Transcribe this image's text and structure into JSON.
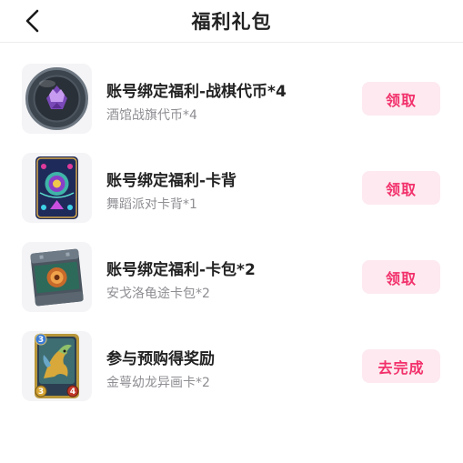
{
  "header": {
    "title": "福利礼包",
    "back_icon": "chevron-left-icon"
  },
  "colors": {
    "accent": "#f2306b",
    "button_bg": "#fde9ef",
    "subtitle": "#8e8e93"
  },
  "rewards": [
    {
      "title": "账号绑定福利-战棋代币*4",
      "subtitle": "酒馆战旗代币*4",
      "button": "领取",
      "icon": "battlegrounds-token-icon"
    },
    {
      "title": "账号绑定福利-卡背",
      "subtitle": "舞蹈派对卡背*1",
      "button": "领取",
      "icon": "card-back-icon"
    },
    {
      "title": "账号绑定福利-卡包*2",
      "subtitle": "安戈洛龟途卡包*2",
      "button": "领取",
      "icon": "card-pack-icon"
    },
    {
      "title": "参与预购得奖励",
      "subtitle": "金萼幼龙异画卡*2",
      "button": "去完成",
      "icon": "dragon-card-icon",
      "card_cost": "3",
      "card_attack": "3",
      "card_health": "4"
    }
  ]
}
